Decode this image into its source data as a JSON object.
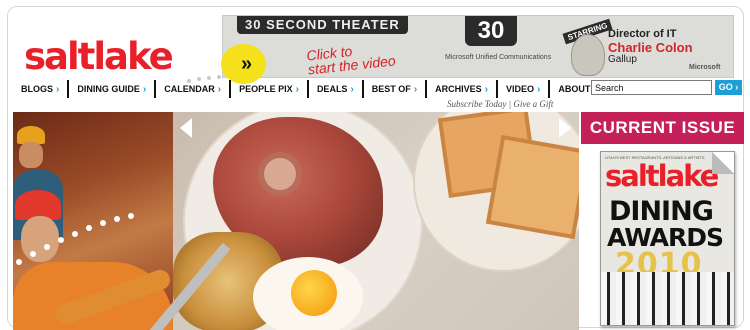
{
  "site": {
    "logo_text": "saltlake",
    "badge_symbol": "»"
  },
  "ad": {
    "title": "30 SECOND THEATER",
    "number": "30",
    "click_line1": "Click to",
    "click_line2": "start the video",
    "ms_text": "Microsoft Unified Communications",
    "starring": "STARRING",
    "director": "Director of IT",
    "name": "Charlie Colon",
    "company": "Gallup",
    "brand": "Microsoft"
  },
  "nav": {
    "items": [
      {
        "label": "BLOGS"
      },
      {
        "label": "DINING GUIDE"
      },
      {
        "label": "CALENDAR"
      },
      {
        "label": "PEOPLE PIX"
      },
      {
        "label": "DEALS"
      },
      {
        "label": "BEST OF"
      },
      {
        "label": "ARCHIVES"
      },
      {
        "label": "VIDEO"
      },
      {
        "label": "ABOUT US"
      }
    ],
    "chevron": "›"
  },
  "search": {
    "value": "Search",
    "go_label": "GO ›"
  },
  "subscribe": {
    "text": "Subscribe Today | Give a Gift"
  },
  "issue": {
    "heading": "CURRENT ISSUE",
    "cover_tagline": "UTAH'S BEST RESTAURANTS, ARTISANS & ARTISTS",
    "cover_logo": "saltlake",
    "cover_line1": "DINING",
    "cover_line2": "AWARDS",
    "cover_year": "2010"
  }
}
